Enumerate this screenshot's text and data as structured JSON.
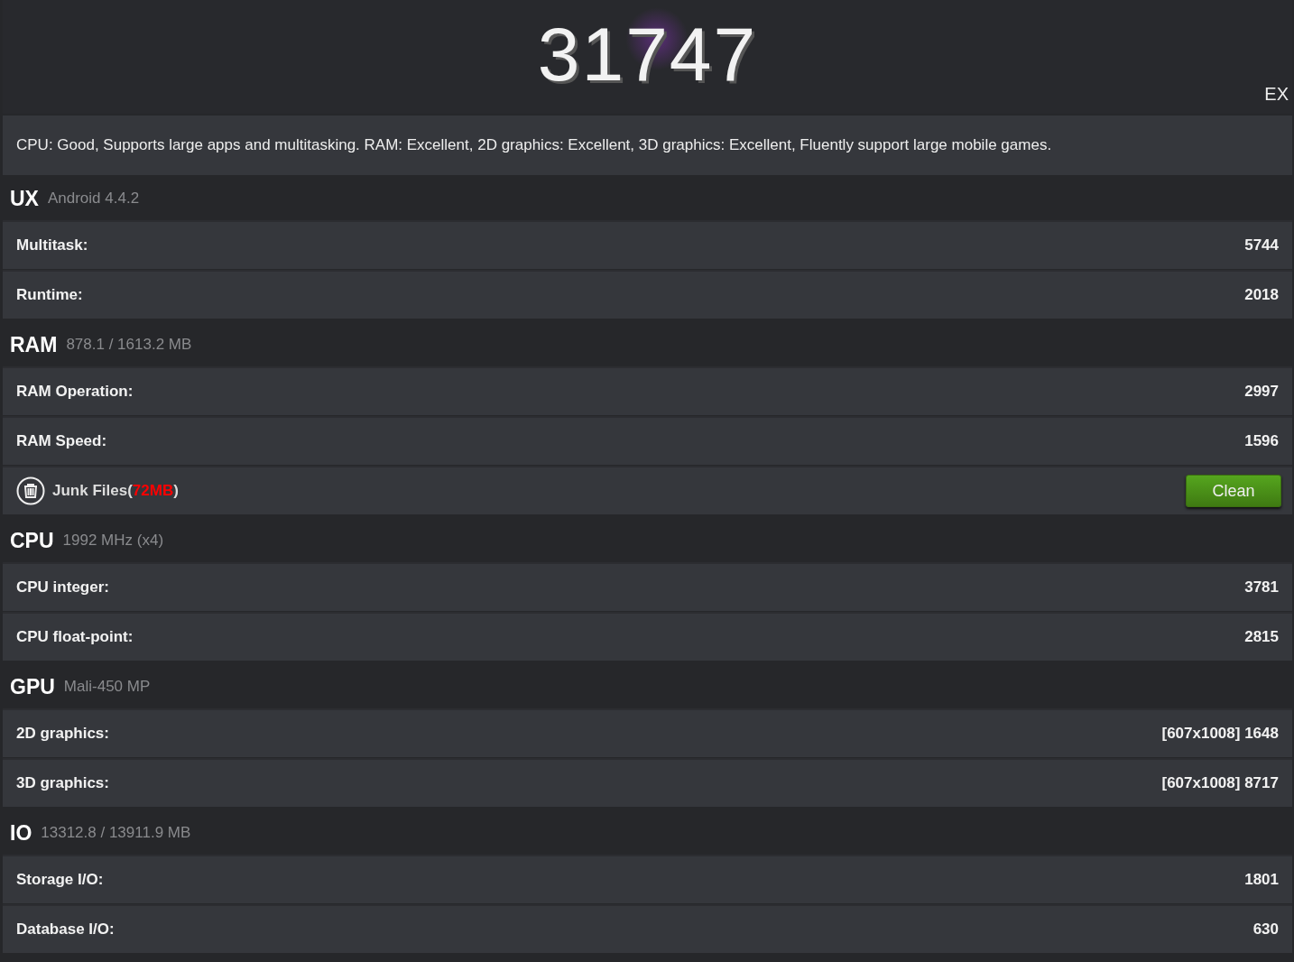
{
  "score": "31747",
  "edition": "EX",
  "summary": "CPU: Good, Supports large apps and multitasking. RAM: Excellent, 2D graphics: Excellent, 3D graphics: Excellent, Fluently support large mobile games.",
  "sections": [
    {
      "title": "UX",
      "detail": "Android 4.4.2",
      "rows": [
        {
          "kind": "score",
          "label": "Multitask:",
          "value": "5744"
        },
        {
          "kind": "score",
          "label": "Runtime:",
          "value": "2018"
        }
      ]
    },
    {
      "title": "RAM",
      "detail": "878.1 / 1613.2 MB",
      "rows": [
        {
          "kind": "score",
          "label": "RAM Operation:",
          "value": "2997"
        },
        {
          "kind": "score",
          "label": "RAM Speed:",
          "value": "1596"
        },
        {
          "kind": "junk",
          "label": "Junk Files(",
          "size": "72MB",
          "suffix": ")",
          "button": "Clean"
        }
      ]
    },
    {
      "title": "CPU",
      "detail": "1992 MHz (x4)",
      "rows": [
        {
          "kind": "score",
          "label": "CPU integer:",
          "value": "3781"
        },
        {
          "kind": "score",
          "label": "CPU float-point:",
          "value": "2815"
        }
      ]
    },
    {
      "title": "GPU",
      "detail": "Mali-450 MP",
      "rows": [
        {
          "kind": "score",
          "label": "2D graphics:",
          "value": "[607x1008] 1648"
        },
        {
          "kind": "score",
          "label": "3D graphics:",
          "value": "[607x1008] 8717"
        }
      ]
    },
    {
      "title": "IO",
      "detail": "13312.8 / 13911.9 MB",
      "rows": [
        {
          "kind": "score",
          "label": "Storage I/O:",
          "value": "1801"
        },
        {
          "kind": "score",
          "label": "Database I/O:",
          "value": "630"
        }
      ]
    }
  ]
}
